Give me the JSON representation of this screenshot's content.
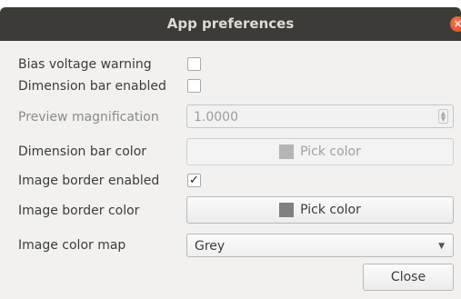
{
  "window": {
    "title": "App preferences"
  },
  "fields": {
    "bias_voltage_warning": {
      "label": "Bias voltage warning",
      "checked": false
    },
    "dimension_bar_enabled": {
      "label": "Dimension bar enabled",
      "checked": false
    },
    "preview_magnification": {
      "label": "Preview magnification",
      "value": "1.0000",
      "enabled": false
    },
    "dimension_bar_color": {
      "label": "Dimension bar color",
      "button_label": "Pick color",
      "swatch_color": "#b5b5b5",
      "enabled": false
    },
    "image_border_enabled": {
      "label": "Image border enabled",
      "checked": true,
      "checkmark": "✓"
    },
    "image_border_color": {
      "label": "Image border color",
      "button_label": "Pick color",
      "swatch_color": "#808080",
      "enabled": true
    },
    "image_color_map": {
      "label": "Image color map",
      "selected": "Grey"
    }
  },
  "buttons": {
    "close_label": "Close"
  },
  "icons": {
    "window_close": "close-icon",
    "combo_arrow": "chevron-down-icon",
    "spin_arrows": "spin-arrows-icon"
  },
  "colors": {
    "titlebar": "#3c3b37",
    "close_button": "#e0471d",
    "dialog_background": "#f2f1f0"
  }
}
